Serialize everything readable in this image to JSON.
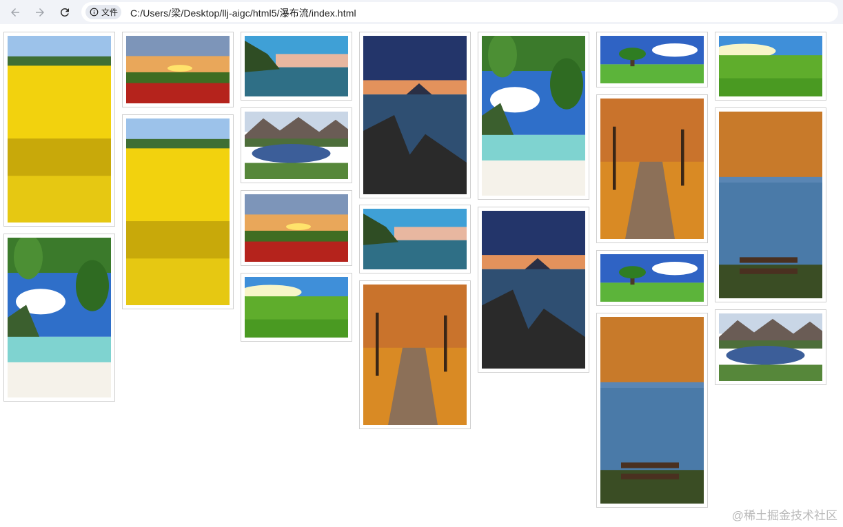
{
  "browser": {
    "site_info_label": "文件",
    "url": "C:/Users/梁/Desktop/llj-aigc/html5/瀑布流/index.html"
  },
  "gallery": {
    "images": [
      {
        "scene": "rapeseed-field"
      },
      {
        "scene": "tropical-beach"
      },
      {
        "scene": "sunset-poppies"
      },
      {
        "scene": "rapeseed-field"
      },
      {
        "scene": "lake-dawn"
      },
      {
        "scene": "mountain-lake"
      },
      {
        "scene": "sunset-poppies"
      },
      {
        "scene": "green-meadow"
      },
      {
        "scene": "volcano-seascape"
      },
      {
        "scene": "lake-dawn"
      },
      {
        "scene": "autumn-path"
      },
      {
        "scene": "tropical-beach"
      },
      {
        "scene": "volcano-seascape"
      },
      {
        "scene": "tree-meadow"
      },
      {
        "scene": "autumn-path"
      },
      {
        "scene": "tree-meadow"
      },
      {
        "scene": "autumn-bench"
      },
      {
        "scene": "green-meadow"
      },
      {
        "scene": "autumn-bench"
      },
      {
        "scene": "mountain-lake"
      }
    ]
  },
  "watermark": "@稀土掘金技术社区",
  "colors": {
    "toolbar_bg": "#f1f3f8",
    "card_border": "#cfcfcf"
  }
}
